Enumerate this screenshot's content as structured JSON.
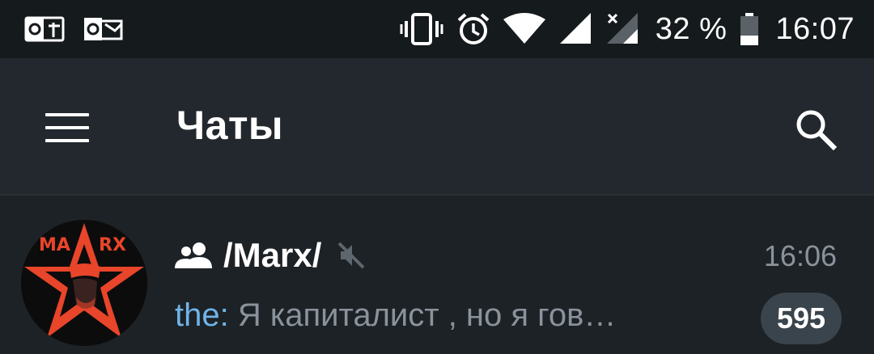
{
  "status_bar": {
    "left_icons": [
      "outlook-icon",
      "outlook-mail-icon"
    ],
    "right_icons": [
      "vibrate-icon",
      "alarm-icon",
      "wifi-icon",
      "signal-icon",
      "signal-no-data-icon",
      "battery-icon"
    ],
    "battery_percent": "32 %",
    "time": "16:07"
  },
  "app_bar": {
    "title": "Чаты",
    "menu_icon": "hamburger-menu-icon",
    "search_icon": "search-icon"
  },
  "chats": [
    {
      "name": "/Marx/",
      "type_icon": "group-icon",
      "muted": true,
      "time": "16:06",
      "preview_sender": "the:",
      "preview_text": " Я капиталист , но я гов…",
      "unread_count": "595",
      "avatar_text": "MARX",
      "avatar_colors": {
        "star": "#e8452a",
        "text": "#e8452a",
        "bg": "#0c0c0c"
      }
    }
  ],
  "colors": {
    "status_bar_bg": "#151a1d",
    "app_bar_bg": "#22282e",
    "list_bg": "#1d2226",
    "secondary_text": "#8a939b",
    "sender_accent": "#6fb4e8",
    "badge_bg": "#3a444c"
  }
}
